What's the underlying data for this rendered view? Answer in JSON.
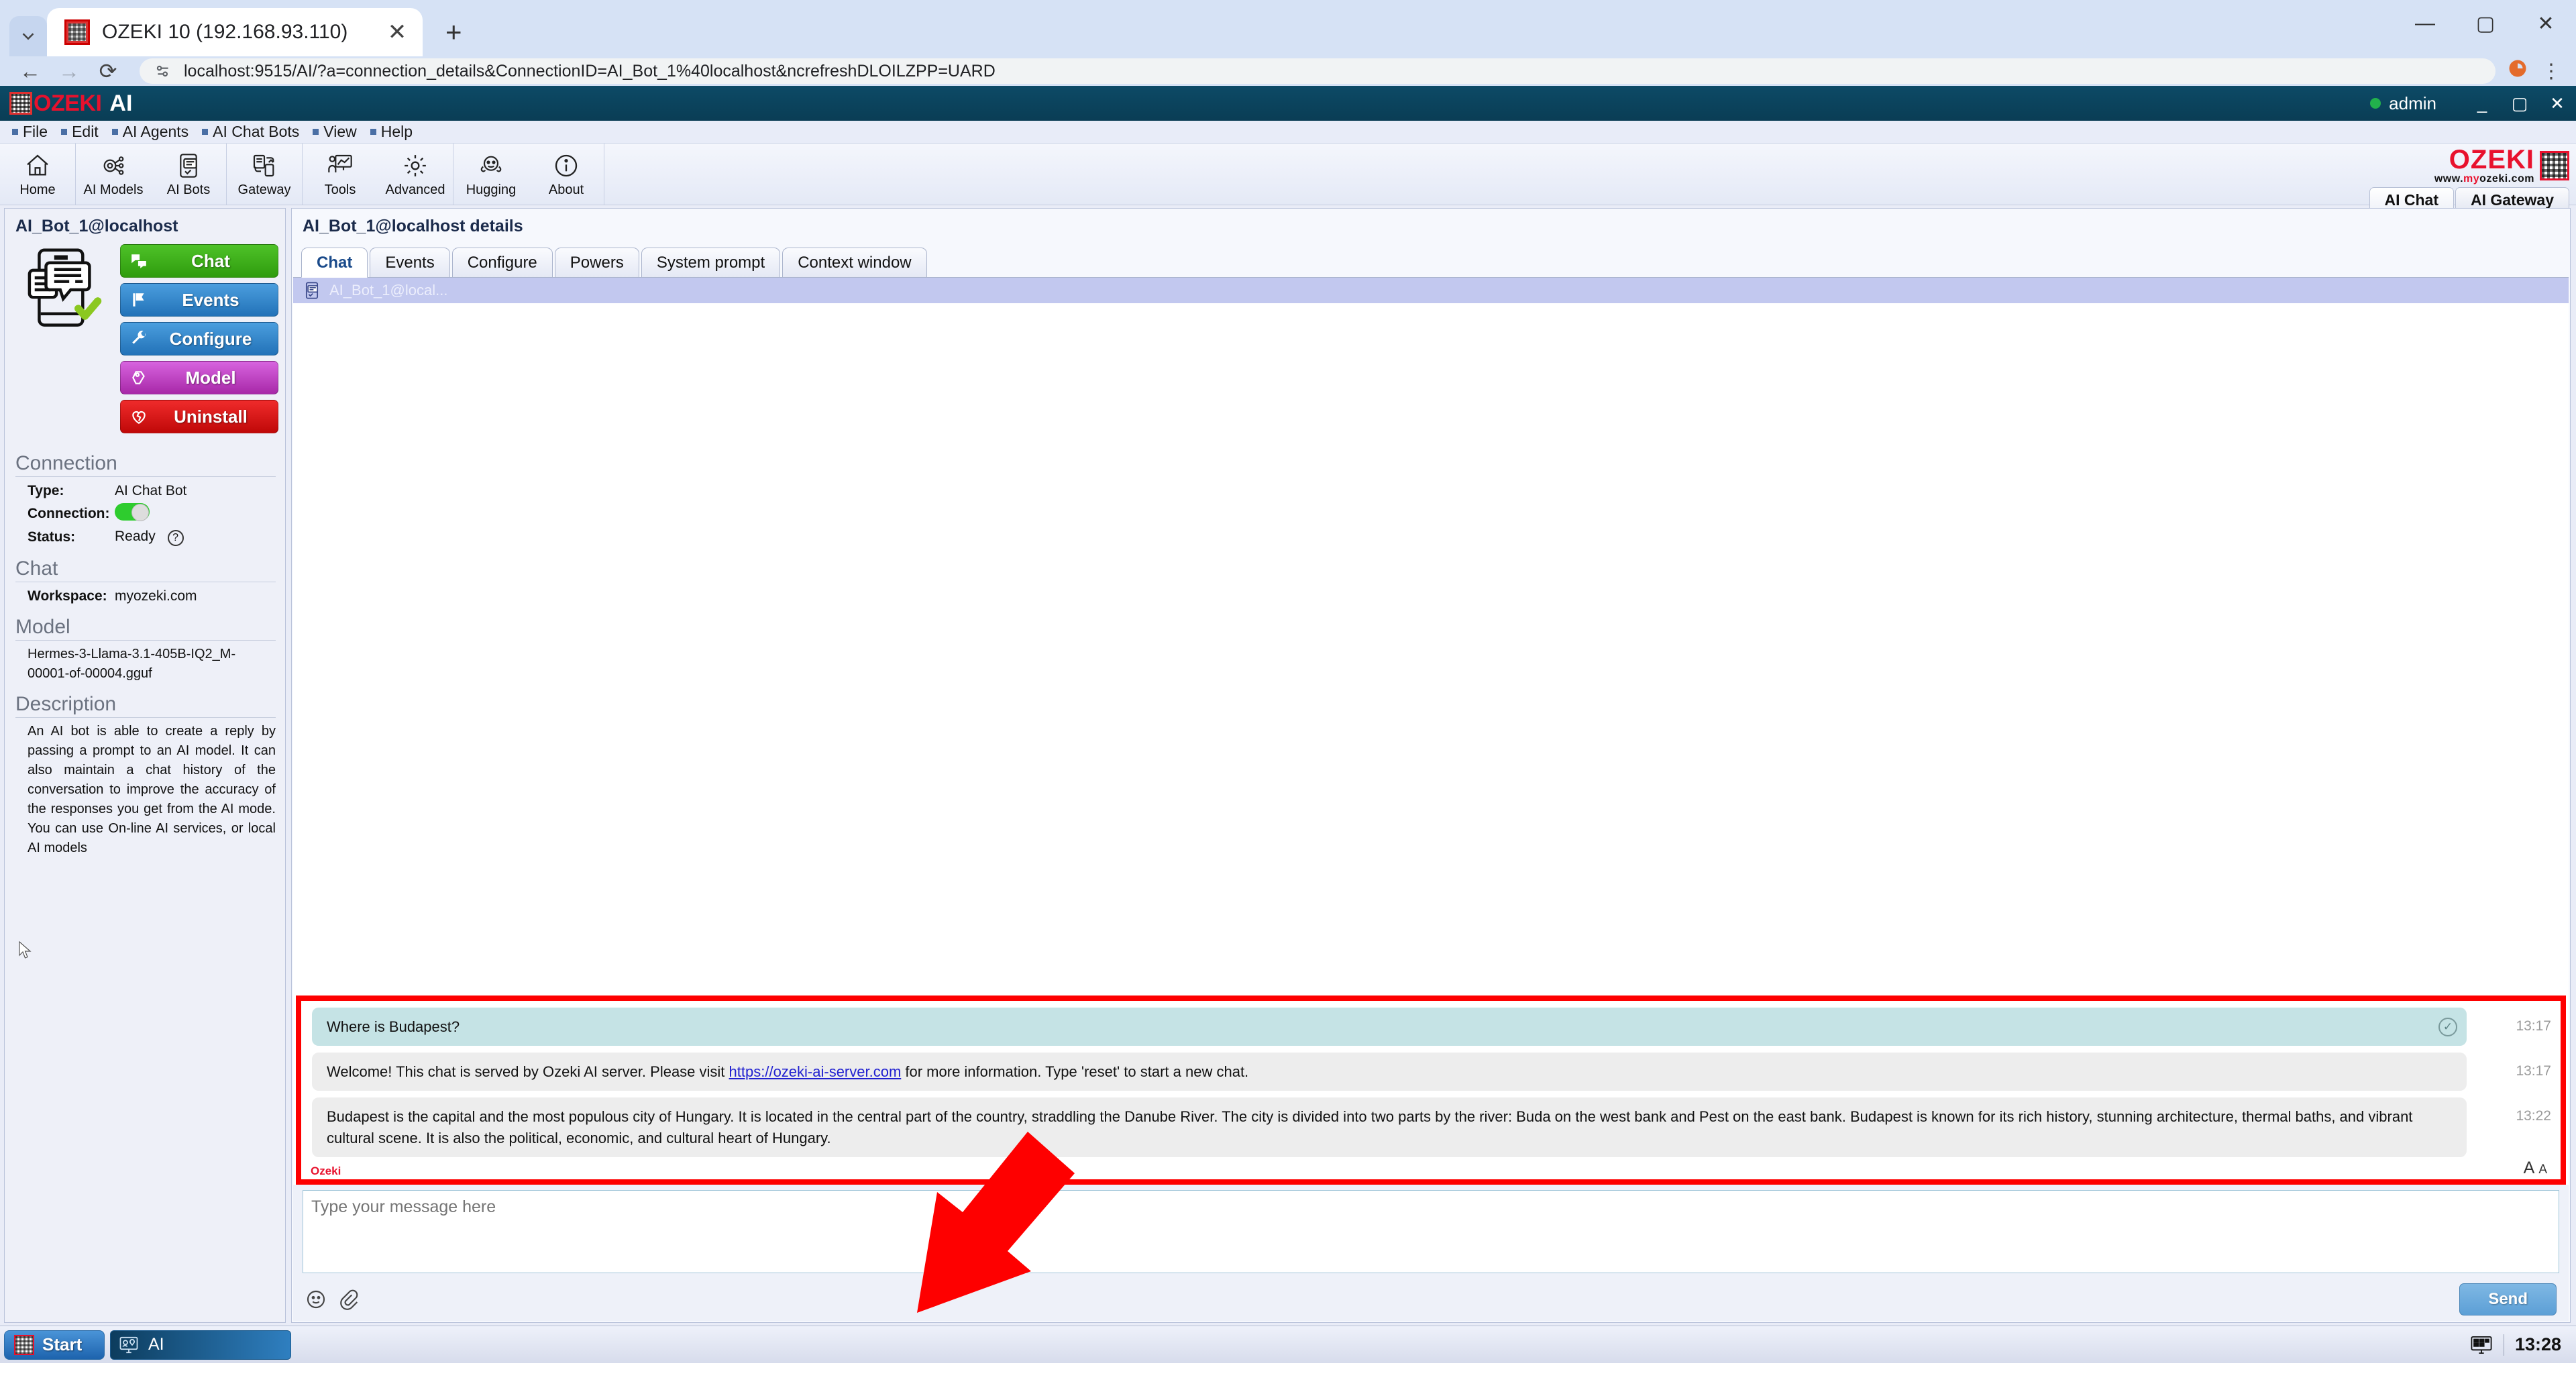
{
  "browser": {
    "tab": {
      "title": "OZEKI 10 (192.168.93.110)",
      "close_label": "✕"
    },
    "new_tab_label": "+",
    "url": "localhost:9515/AI/?a=connection_details&ConnectionID=AI_Bot_1%40localhost&ncrefreshDLOILZPP=UARD",
    "window": {
      "minimize": "—",
      "maximize": "▢",
      "close": "✕"
    }
  },
  "ozeki": {
    "brand_word": "OZEKI",
    "brand_suffix": "AI",
    "admin_label": "admin",
    "window": {
      "minimize": "_",
      "maximize": "▢",
      "close": "✕"
    },
    "menus": [
      "File",
      "Edit",
      "AI Agents",
      "AI Chat Bots",
      "View",
      "Help"
    ],
    "ribbon": [
      {
        "label": "Home",
        "icon": "home-icon"
      },
      {
        "label": "AI Models",
        "icon": "ai-models-icon"
      },
      {
        "label": "AI Bots",
        "icon": "ai-bots-icon"
      },
      {
        "label": "Gateway",
        "icon": "gateway-icon"
      },
      {
        "label": "Tools",
        "icon": "tools-icon"
      },
      {
        "label": "Advanced",
        "icon": "advanced-gear-icon"
      },
      {
        "label": "Hugging",
        "icon": "hugging-face-icon"
      },
      {
        "label": "About",
        "icon": "info-icon"
      }
    ],
    "brand_logo": {
      "name": "OZEKI",
      "url_prefix": "www.",
      "url_red": "my",
      "url_rest": "ozeki.com"
    },
    "app_tabs": [
      {
        "label": "AI Chat",
        "active": true
      },
      {
        "label": "AI Gateway",
        "active": false
      }
    ]
  },
  "sidebar": {
    "title": "AI_Bot_1@localhost",
    "buttons": [
      {
        "label": "Chat",
        "style": "green",
        "icon": "chat-bubbles-icon"
      },
      {
        "label": "Events",
        "style": "blue",
        "icon": "flag-icon"
      },
      {
        "label": "Configure",
        "style": "blue",
        "icon": "wrench-icon"
      },
      {
        "label": "Model",
        "style": "purple",
        "icon": "model-icon"
      },
      {
        "label": "Uninstall",
        "style": "red",
        "icon": "broken-heart-icon"
      }
    ],
    "connection": {
      "heading": "Connection",
      "type_label": "Type:",
      "type_value": "AI Chat Bot",
      "connection_label": "Connection:",
      "connection_on": true,
      "status_label": "Status:",
      "status_value": "Ready",
      "help_glyph": "?"
    },
    "chat": {
      "heading": "Chat",
      "workspace_label": "Workspace:",
      "workspace_value": "myozeki.com"
    },
    "model": {
      "heading": "Model",
      "value": "Hermes-3-Llama-3.1-405B-IQ2_M-00001-of-00004.gguf"
    },
    "description": {
      "heading": "Description",
      "text": "An AI bot is able to create a reply by passing a prompt to an AI model. It can also maintain a chat history of the conversation to improve the accuracy of the responses you get from the AI mode. You can use On-line AI services, or local AI models"
    }
  },
  "main": {
    "title": "AI_Bot_1@localhost details",
    "tabs": [
      {
        "label": "Chat",
        "active": true
      },
      {
        "label": "Events",
        "active": false
      },
      {
        "label": "Configure",
        "active": false
      },
      {
        "label": "Powers",
        "active": false
      },
      {
        "label": "System prompt",
        "active": false
      },
      {
        "label": "Context window",
        "active": false
      }
    ],
    "conversation_header": "AI_Bot_1@local...",
    "messages": [
      {
        "direction": "out",
        "text": "Where is Budapest?",
        "time": "13:17",
        "delivered": true
      },
      {
        "direction": "in",
        "text": "Welcome! This chat is served by Ozeki AI server. Please visit https://ozeki-ai-server.com for more information. Type 'reset' to start a new chat.",
        "link": "https://ozeki-ai-server.com",
        "time": "13:17",
        "delivered": false
      },
      {
        "direction": "in",
        "text": "Budapest is the capital and the most populous city of Hungary. It is located in the central part of the country, straddling the Danube River. The city is divided into two parts by the river: Buda on the west bank and Pest on the east bank. Budapest is known for its rich history, stunning architecture, thermal baths, and vibrant cultural scene. It is also the political, economic, and cultural heart of Hungary.",
        "time": "13:22",
        "delivered": false
      }
    ],
    "footer_label": "Ozeki",
    "font_size_big": "A",
    "font_size_small": "A",
    "composer": {
      "placeholder": "Type your message here",
      "value": "",
      "send_label": "Send",
      "emoji_icon": "smiley-icon",
      "attach_icon": "paperclip-icon"
    }
  },
  "taskbar": {
    "start_label": "Start",
    "task_label": "AI",
    "clock": "13:28"
  },
  "colors": {
    "accent_red": "#e8112d",
    "highlight_red": "#fe0000",
    "titlebar": "#0a3d55",
    "bubble_out": "#c5e3e5",
    "bubble_in": "#ededed",
    "status_green": "#2ecc2e"
  }
}
